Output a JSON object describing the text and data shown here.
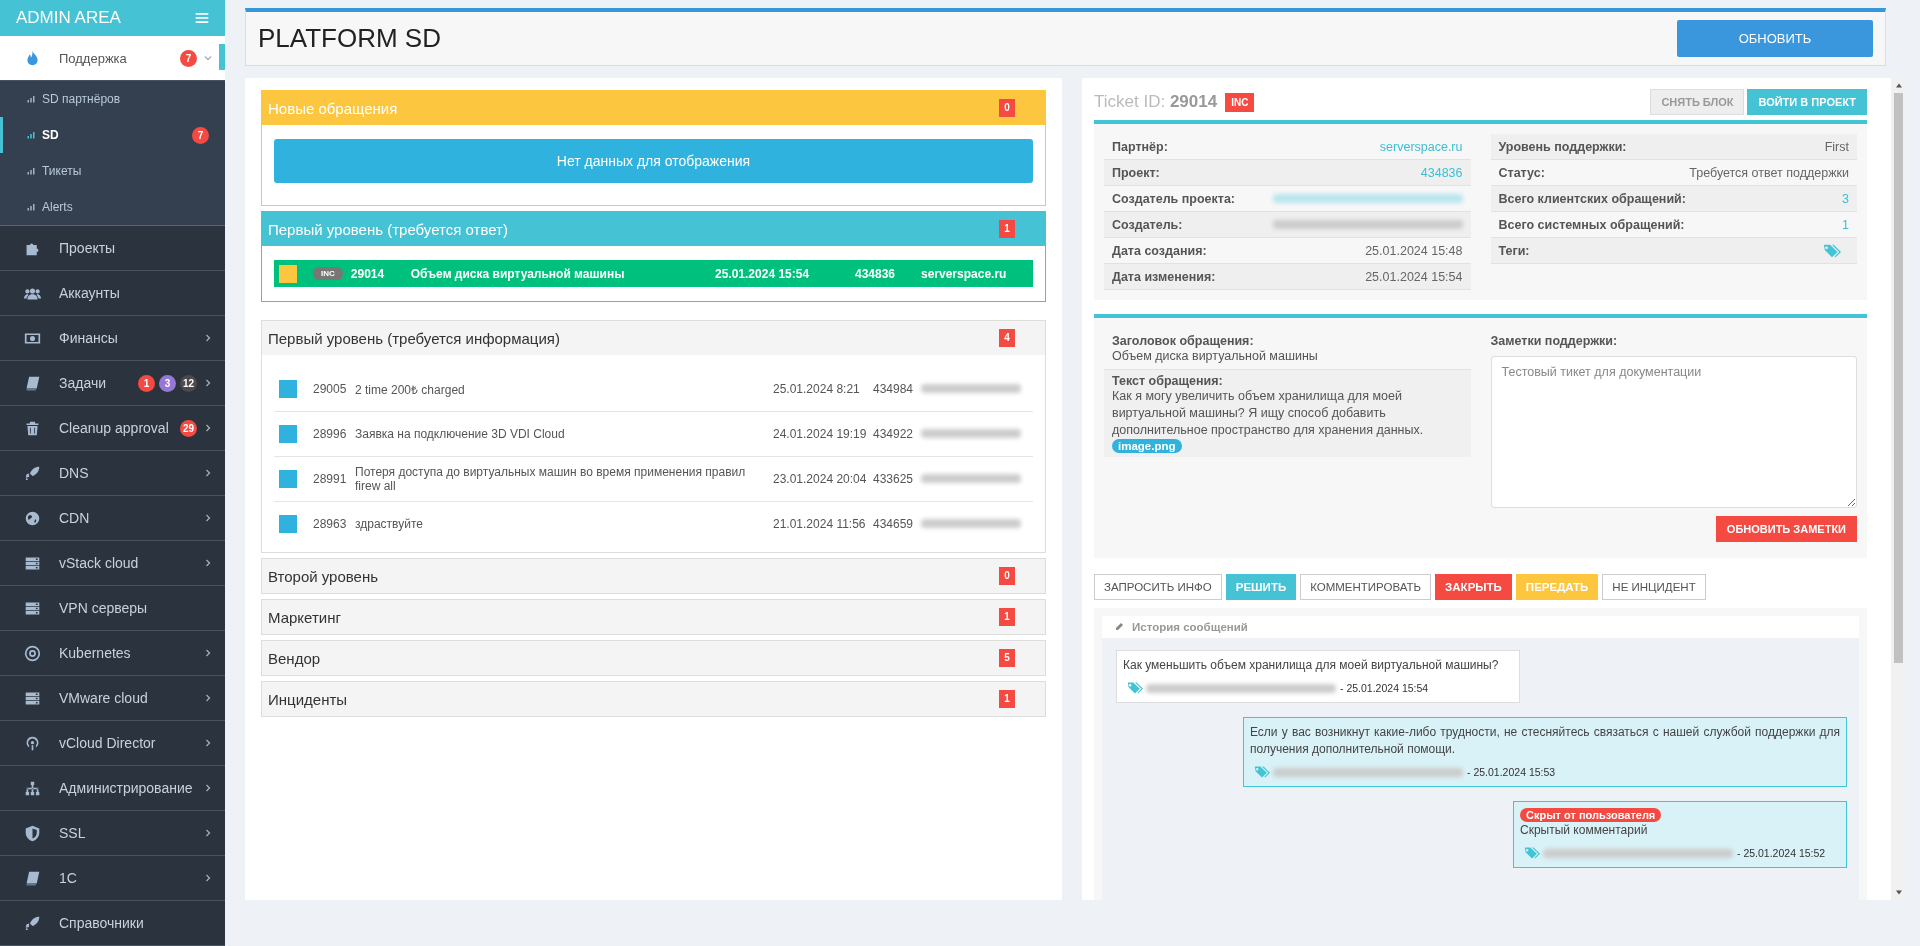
{
  "sidebar": {
    "title": "ADMIN AREA",
    "items": [
      {
        "label": "Поддержка",
        "selected": true,
        "expanded": true,
        "has_submenu": true,
        "badges": [
          {
            "text": "7",
            "color": "#f44a42"
          }
        ],
        "children": [
          {
            "label": "SD партнёров",
            "selected": false
          },
          {
            "label": "SD",
            "selected": true,
            "badge": "7"
          },
          {
            "label": "Тикеты",
            "selected": false
          },
          {
            "label": "Alerts",
            "selected": false
          }
        ]
      },
      {
        "label": "Проекты",
        "selected": false,
        "has_submenu": false
      },
      {
        "label": "Аккаунты",
        "selected": false,
        "has_submenu": false
      },
      {
        "label": "Финансы",
        "selected": false,
        "expanded": false,
        "has_submenu": true
      },
      {
        "label": "Задачи",
        "selected": false,
        "expanded": false,
        "has_submenu": true,
        "badges": [
          {
            "text": "1",
            "color": "#f44a42"
          },
          {
            "text": "3",
            "color": "#9577d6"
          },
          {
            "text": "12",
            "color": "#4b4b4b"
          }
        ]
      },
      {
        "label": "Cleanup approval",
        "selected": false,
        "expanded": false,
        "has_submenu": true,
        "badges": [
          {
            "text": "29",
            "color": "#f44a42"
          }
        ]
      },
      {
        "label": "DNS",
        "selected": false,
        "expanded": false,
        "has_submenu": true
      },
      {
        "label": "CDN",
        "selected": false,
        "expanded": false,
        "has_submenu": true
      },
      {
        "label": "vStack cloud",
        "selected": false,
        "expanded": false,
        "has_submenu": true
      },
      {
        "label": "VPN серверы",
        "selected": false,
        "has_submenu": false
      },
      {
        "label": "Kubernetes",
        "selected": false,
        "expanded": false,
        "has_submenu": true
      },
      {
        "label": "VMware cloud",
        "selected": false,
        "expanded": false,
        "has_submenu": true
      },
      {
        "label": "vCloud Director",
        "selected": false,
        "expanded": false,
        "has_submenu": true
      },
      {
        "label": "Администрирование",
        "selected": false,
        "expanded": false,
        "has_submenu": true
      },
      {
        "label": "SSL",
        "selected": false,
        "expanded": false,
        "has_submenu": true
      },
      {
        "label": "1C",
        "selected": false,
        "expanded": false,
        "has_submenu": true
      },
      {
        "label": "Справочники",
        "selected": false,
        "has_submenu": false
      }
    ]
  },
  "header": {
    "title": "PLATFORM SD",
    "button": "ОБНОВИТЬ"
  },
  "queues": [
    {
      "title": "Новые обращения",
      "count": "0",
      "kind": "warning",
      "expanded": true,
      "empty_message": "Нет данных для отображения"
    },
    {
      "title": "Первый уровень (требуется ответ)",
      "count": "1",
      "kind": "info",
      "expanded": true,
      "tickets": [
        {
          "id": "29014",
          "tag": "INC",
          "subject": "Объем диска виртуальной машины",
          "date": "25.01.2024 15:54",
          "project": "434836",
          "partner": "serverspace.ru",
          "color": "#fdc63f",
          "selected": true
        }
      ]
    },
    {
      "title": "Первый уровень (требуется информация)",
      "count": "4",
      "kind": "default",
      "expanded": true,
      "tickets": [
        {
          "id": "29005",
          "subject": "2 time 200₺ charged",
          "date": "25.01.2024 8:21",
          "project": "434984",
          "color": "#30b2df",
          "selected": false
        },
        {
          "id": "28996",
          "subject": "Заявка на подключение 3D VDI Cloud",
          "date": "24.01.2024 19:19",
          "project": "434922",
          "color": "#30b2df",
          "selected": false
        },
        {
          "id": "28991",
          "subject": "Потеря доступа до виртуальных машин во время применения правил firew all",
          "date": "23.01.2024 20:04",
          "project": "433625",
          "color": "#30b2df",
          "selected": false
        },
        {
          "id": "28963",
          "subject": "здраствуйте",
          "date": "21.01.2024 11:56",
          "project": "434659",
          "color": "#30b2df",
          "selected": false
        }
      ]
    },
    {
      "title": "Второй уровень",
      "count": "0",
      "kind": "default",
      "expanded": false
    },
    {
      "title": "Маркетинг",
      "count": "1",
      "kind": "default",
      "expanded": false
    },
    {
      "title": "Вендор",
      "count": "5",
      "kind": "default",
      "expanded": false
    },
    {
      "title": "Инциденты",
      "count": "1",
      "kind": "default",
      "expanded": false
    }
  ],
  "ticket": {
    "label": "Ticket ID:",
    "id": "29014",
    "tag": "INC",
    "buttons": [
      {
        "label": "СНЯТЬ БЛОК",
        "kind": "default"
      },
      {
        "label": "ВОЙТИ В ПРОЕКТ",
        "kind": "info"
      }
    ],
    "info_left": [
      {
        "label": "Партнёр:",
        "value": "serverspace.ru",
        "kind": "link"
      },
      {
        "label": "Проект:",
        "value": "434836",
        "kind": "link"
      },
      {
        "label": "Создатель проекта:",
        "kind": "blurred_link"
      },
      {
        "label": "Создатель:",
        "kind": "blurred"
      },
      {
        "label": "Дата создания:",
        "value": "25.01.2024 15:48",
        "kind": "text"
      },
      {
        "label": "Дата изменения:",
        "value": "25.01.2024 15:54",
        "kind": "text"
      }
    ],
    "info_right": [
      {
        "label": "Уровень поддержки:",
        "value": "First",
        "kind": "text"
      },
      {
        "label": "Статус:",
        "value": "Требуется ответ поддержки",
        "kind": "text"
      },
      {
        "label": "Всего клиентских обращений:",
        "value": "3",
        "kind": "link"
      },
      {
        "label": "Всего системных обращений:",
        "value": "1",
        "kind": "link"
      },
      {
        "label": "Теги:",
        "kind": "tags"
      }
    ],
    "subject_label": "Заголовок обращения:",
    "subject": "Объем диска виртуальной машины",
    "text_label": "Текст обращения:",
    "text": "Как я могу увеличить объем хранилища для моей виртуальной машины? Я ищу способ добавить дополнительное пространство для хранения данных.",
    "attachment": "image.png",
    "notes_label": "Заметки поддержки:",
    "notes": "Тестовый тикет для документации",
    "notes_button": "ОБНОВИТЬ ЗАМЕТКИ",
    "actions": [
      {
        "label": "ЗАПРОСИТЬ ИНФО",
        "kind": "default"
      },
      {
        "label": "РЕШИТЬ",
        "kind": "info"
      },
      {
        "label": "КОММЕНТИРОВАТЬ",
        "kind": "default"
      },
      {
        "label": "ЗАКРЫТЬ",
        "kind": "danger"
      },
      {
        "label": "ПЕРЕДАТЬ",
        "kind": "warning"
      },
      {
        "label": "НЕ ИНЦИДЕНТ",
        "kind": "default"
      }
    ],
    "history_title": "История сообщений",
    "messages": [
      {
        "kind": "incoming",
        "text": "Как уменьшить объем хранилища для моей виртуальной машины?",
        "date": "- 25.01.2024 15:54"
      },
      {
        "kind": "outgoing",
        "text": "Если у вас возникнут какие-либо трудности, не стесняйтесь связаться с нашей службой поддержки для получения дополнительной помощи.",
        "date": "- 25.01.2024 15:53"
      },
      {
        "kind": "outgoing",
        "badge": "Скрыт от пользователя",
        "text": "Скрытый комментарий",
        "date": "- 25.01.2024 15:52"
      }
    ]
  }
}
